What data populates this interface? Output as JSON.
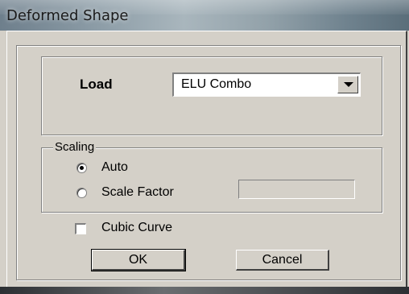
{
  "window": {
    "title": "Deformed Shape"
  },
  "load": {
    "label": "Load",
    "selected": "ELU Combo"
  },
  "scaling": {
    "legend": "Scaling",
    "options": [
      {
        "label": "Auto",
        "checked": true
      },
      {
        "label": "Scale Factor",
        "checked": false
      }
    ],
    "scale_factor_value": ""
  },
  "cubic_curve": {
    "label": "Cubic Curve",
    "checked": false
  },
  "buttons": {
    "ok": "OK",
    "cancel": "Cancel"
  },
  "icons": {
    "combo_arrow": "chevron-down-icon"
  },
  "colors": {
    "dialog_bg": "#d4d0c8"
  }
}
